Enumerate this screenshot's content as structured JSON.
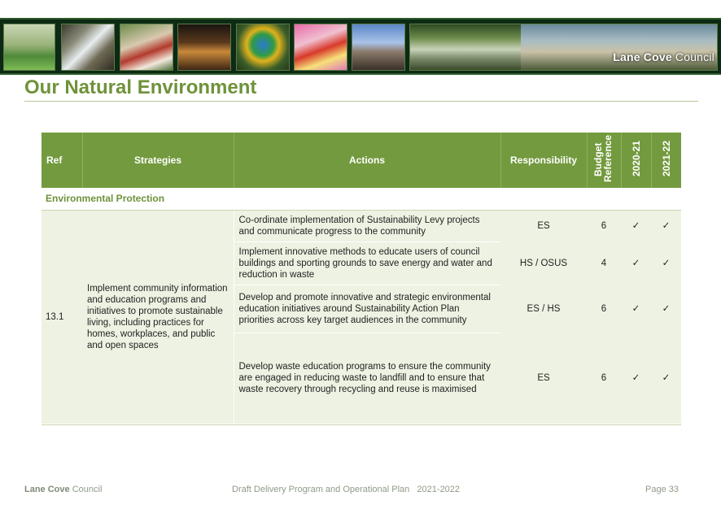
{
  "banner": {
    "brand_bold": "Lane Cove",
    "brand_rest": " Council"
  },
  "page_title": "Our Natural Environment",
  "table": {
    "headers": {
      "ref": "Ref",
      "strategies": "Strategies",
      "actions": "Actions",
      "responsibility": "Responsibility",
      "budget": "Budget Reference",
      "y2020": "2020-21",
      "y2021": "2021-22"
    },
    "section": "Environmental Protection",
    "ref": "13.1",
    "strategy": "Implement community information and education programs and initiatives to promote sustainable living, including practices for homes, workplaces, and public and open spaces",
    "rows": [
      {
        "action": "Co-ordinate implementation of Sustainability Levy projects and communicate progress to the community",
        "resp": "ES",
        "budget": "6",
        "y1": "✓",
        "y2": "✓"
      },
      {
        "action": "Implement innovative methods to educate users of council buildings and sporting grounds to save energy and water and reduction in waste",
        "resp": "HS / OSUS",
        "budget": "4",
        "y1": "✓",
        "y2": "✓"
      },
      {
        "action": "Develop and promote innovative and strategic environmental education initiatives around Sustainability Action Plan priorities across key target audiences in the community",
        "resp": "ES / HS",
        "budget": "6",
        "y1": "✓",
        "y2": "✓"
      },
      {
        "action": "Develop waste education programs to ensure the community are engaged in reducing waste to landfill and to ensure that waste recovery through recycling and reuse is maximised",
        "resp": "ES",
        "budget": "6",
        "y1": "✓",
        "y2": "✓"
      }
    ]
  },
  "footer": {
    "left_bold": "Lane Cove",
    "left_rest": " Council",
    "center": "Draft Delivery Program and Operational Plan   2021-2022",
    "page": "Page 33"
  }
}
